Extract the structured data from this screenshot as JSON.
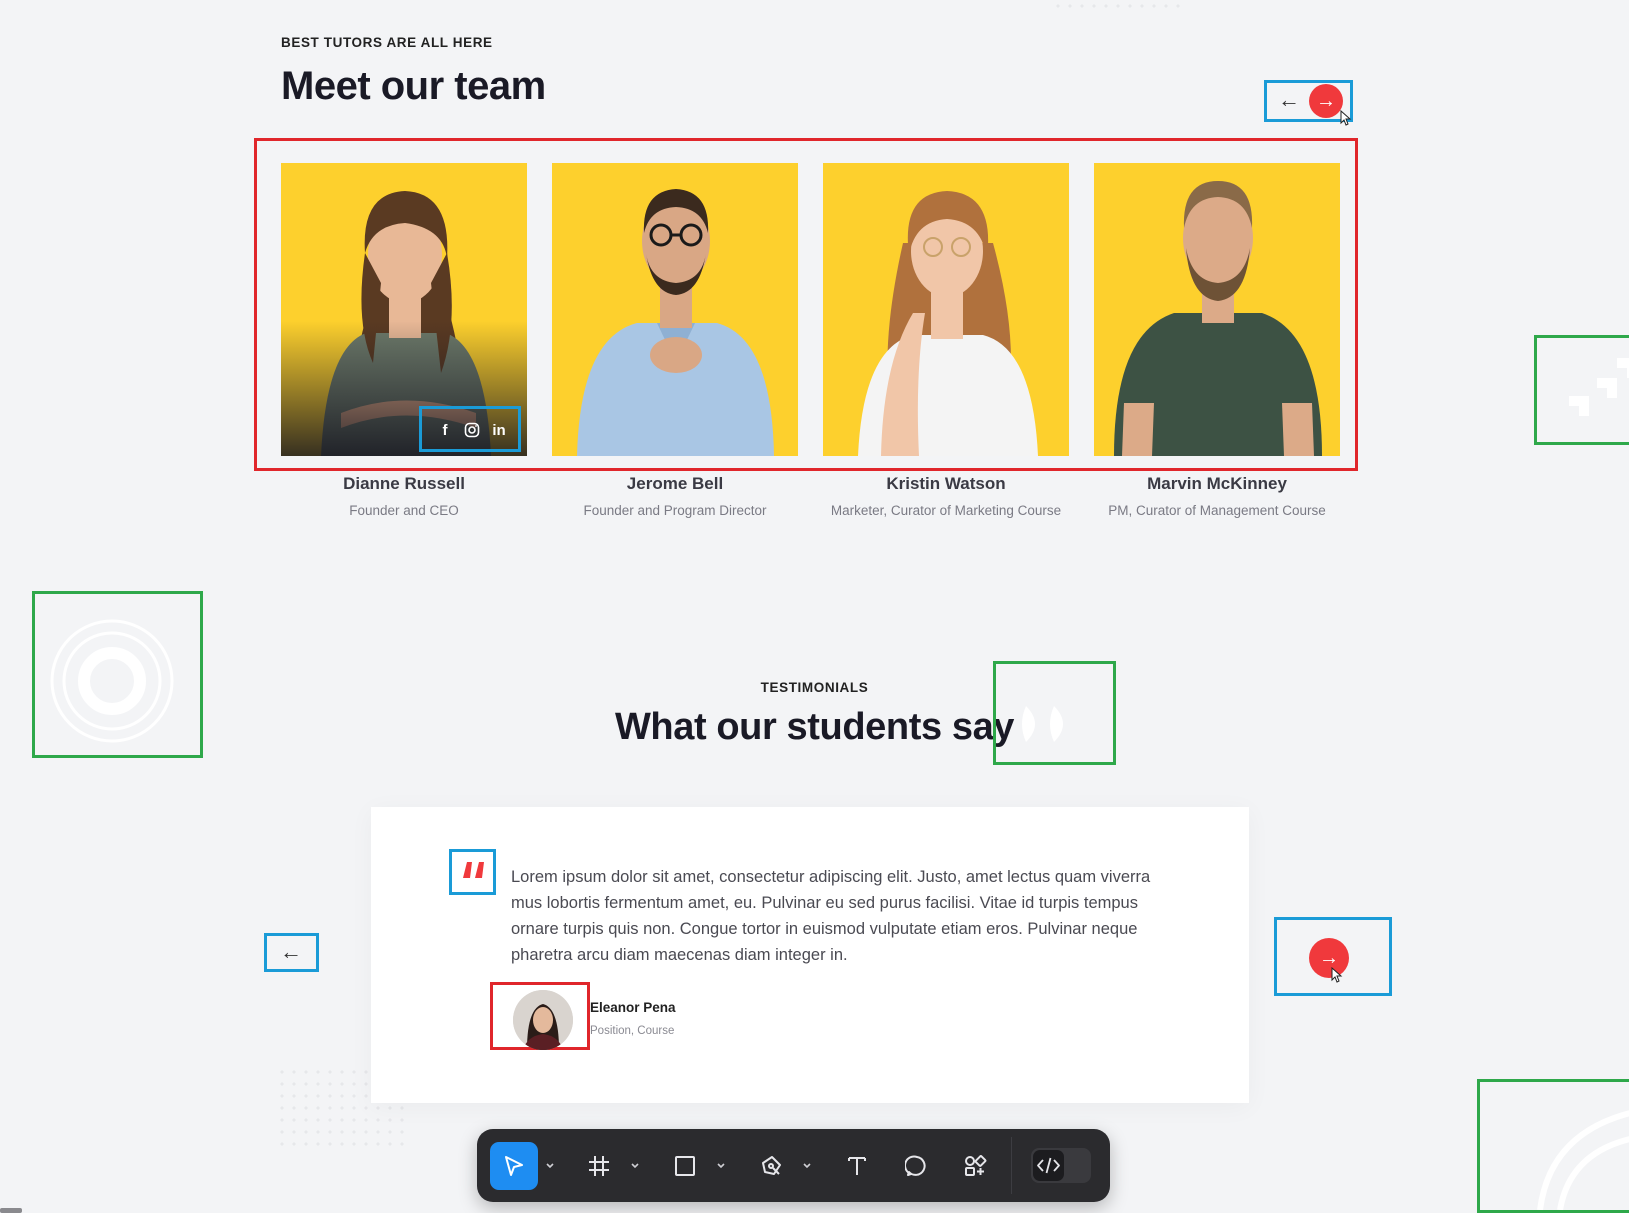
{
  "team_section": {
    "eyebrow": "BEST TUTORS ARE ALL HERE",
    "title": "Meet our team",
    "prev_arrow": "←",
    "next_arrow": "→",
    "members": [
      {
        "name": "Dianne Russell",
        "role": "Founder and CEO",
        "hair": "#5a3a22",
        "shirt": "#6d7a6a",
        "skin": "#e8b896"
      },
      {
        "name": "Jerome Bell",
        "role": "Founder and Program Director",
        "hair": "#3b2a1e",
        "shirt": "#a9c6e4",
        "skin": "#d9a785"
      },
      {
        "name": "Kristin Watson",
        "role": "Marketer, Curator of Marketing Course",
        "hair": "#b0713d",
        "shirt": "#f4f4f4",
        "skin": "#f1c6a8"
      },
      {
        "name": "Marvin McKinney",
        "role": "PM, Curator of Management Course",
        "hair": "#8a6a48",
        "shirt": "#3d5244",
        "skin": "#dcaa88"
      }
    ],
    "social": {
      "facebook": "f",
      "instagram": "instagram-icon",
      "linkedin": "in"
    }
  },
  "testimonials_section": {
    "eyebrow": "TESTIMONIALS",
    "title": "What our students say",
    "quote": "Lorem ipsum dolor sit amet, consectetur adipiscing elit. Justo, amet lectus quam viverra mus lobortis fermentum amet, eu. Pulvinar eu sed purus facilisi. Vitae id turpis tempus ornare turpis quis non. Congue tortor in euismod vulputate etiam eros. Pulvinar neque pharetra arcu diam maecenas diam integer in.",
    "author_name": "Eleanor Pena",
    "author_position": "Position, Course",
    "prev_arrow": "←",
    "next_arrow": "→"
  },
  "toolbar": {
    "tools": [
      "move-tool",
      "frame-tool",
      "shape-tool",
      "pen-tool",
      "text-tool",
      "comment-tool",
      "actions-tool"
    ],
    "active": "move-tool",
    "dev_mode": "off"
  },
  "colors": {
    "accent_red": "#f0393c",
    "card_yellow": "#fdd02d",
    "highlight_blue": "#1a9bd7",
    "highlight_red": "#e0262b",
    "highlight_green": "#2ea84a",
    "toolbar_active": "#1e8df2"
  }
}
